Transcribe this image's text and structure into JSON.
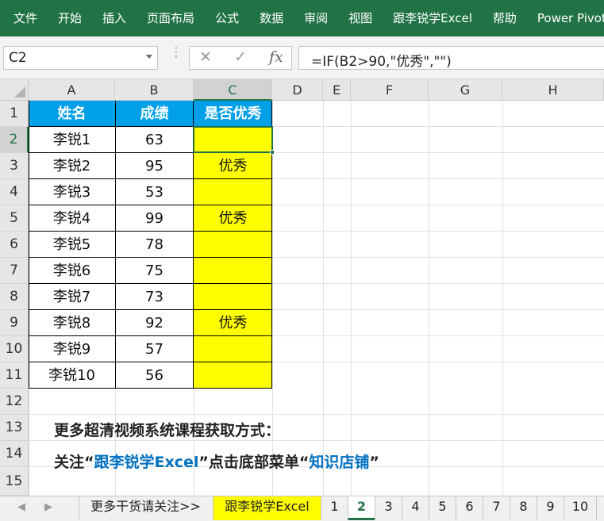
{
  "ribbon": {
    "tabs": [
      "文件",
      "开始",
      "插入",
      "页面布局",
      "公式",
      "数据",
      "审阅",
      "视图",
      "跟李锐学Excel",
      "帮助",
      "Power Pivot"
    ]
  },
  "formula_bar": {
    "name_box": "C2",
    "cancel_glyph": "✕",
    "enter_glyph": "✓",
    "fx_glyph": "fx",
    "formula": "=IF(B2>90,\"优秀\",\"\")"
  },
  "grid": {
    "columns": [
      "A",
      "B",
      "C",
      "D",
      "E",
      "F",
      "G",
      "H"
    ],
    "rows": [
      "1",
      "2",
      "3",
      "4",
      "5",
      "6",
      "7",
      "8",
      "9",
      "10",
      "11",
      "12",
      "13",
      "14",
      "15"
    ],
    "selected_column": "C",
    "selected_row": "2",
    "table": {
      "headers": [
        "姓名",
        "成绩",
        "是否优秀"
      ],
      "rows": [
        [
          "李锐1",
          "63",
          ""
        ],
        [
          "李锐2",
          "95",
          "优秀"
        ],
        [
          "李锐3",
          "53",
          ""
        ],
        [
          "李锐4",
          "99",
          "优秀"
        ],
        [
          "李锐5",
          "78",
          ""
        ],
        [
          "李锐6",
          "75",
          ""
        ],
        [
          "李锐7",
          "73",
          ""
        ],
        [
          "李锐8",
          "92",
          "优秀"
        ],
        [
          "李锐9",
          "57",
          ""
        ],
        [
          "李锐10",
          "56",
          ""
        ]
      ]
    },
    "note_line1": "更多超清视频系统课程获取方式：",
    "note_line2": {
      "part1": "关注“",
      "part2": "跟李锐学Excel",
      "part3": "”点击底部菜单“",
      "part4": "知识店铺",
      "part5": "”"
    }
  },
  "sheet_tabs": {
    "prev_glyph": "◀",
    "next_glyph": "▶",
    "tabs": [
      "更多干货请关注>>",
      "跟李锐学Excel",
      "1",
      "2",
      "3",
      "4",
      "5",
      "6",
      "7",
      "8",
      "9",
      "10"
    ],
    "active": "2"
  },
  "colors": {
    "ribbon": "#217346",
    "header_fill": "#00a0e9",
    "highlight_fill": "#ffff00",
    "note_accent": "#0070c0"
  }
}
